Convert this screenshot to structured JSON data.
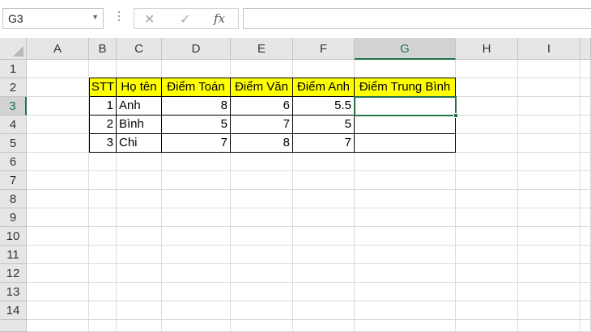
{
  "formula_bar": {
    "name_box": "G3",
    "formula": ""
  },
  "columns": [
    "A",
    "B",
    "C",
    "D",
    "E",
    "F",
    "G",
    "H",
    "I"
  ],
  "rows": [
    "1",
    "2",
    "3",
    "4",
    "5",
    "6",
    "7",
    "8",
    "9",
    "10",
    "11",
    "12",
    "13",
    "14"
  ],
  "selected": {
    "column": "G",
    "row": "3"
  },
  "table": {
    "headers": [
      "STT",
      "Họ tên",
      "Điểm Toán",
      "Điểm Văn",
      "Điểm Anh",
      "Điểm Trung Bình"
    ],
    "rows": [
      [
        "1",
        "Anh",
        "8",
        "6",
        "5.5",
        ""
      ],
      [
        "2",
        "Bình",
        "5",
        "7",
        "5",
        ""
      ],
      [
        "3",
        "Chi",
        "7",
        "8",
        "7",
        ""
      ]
    ]
  },
  "colors": {
    "header_fill": "#ffff00",
    "selection_green": "#217346"
  }
}
